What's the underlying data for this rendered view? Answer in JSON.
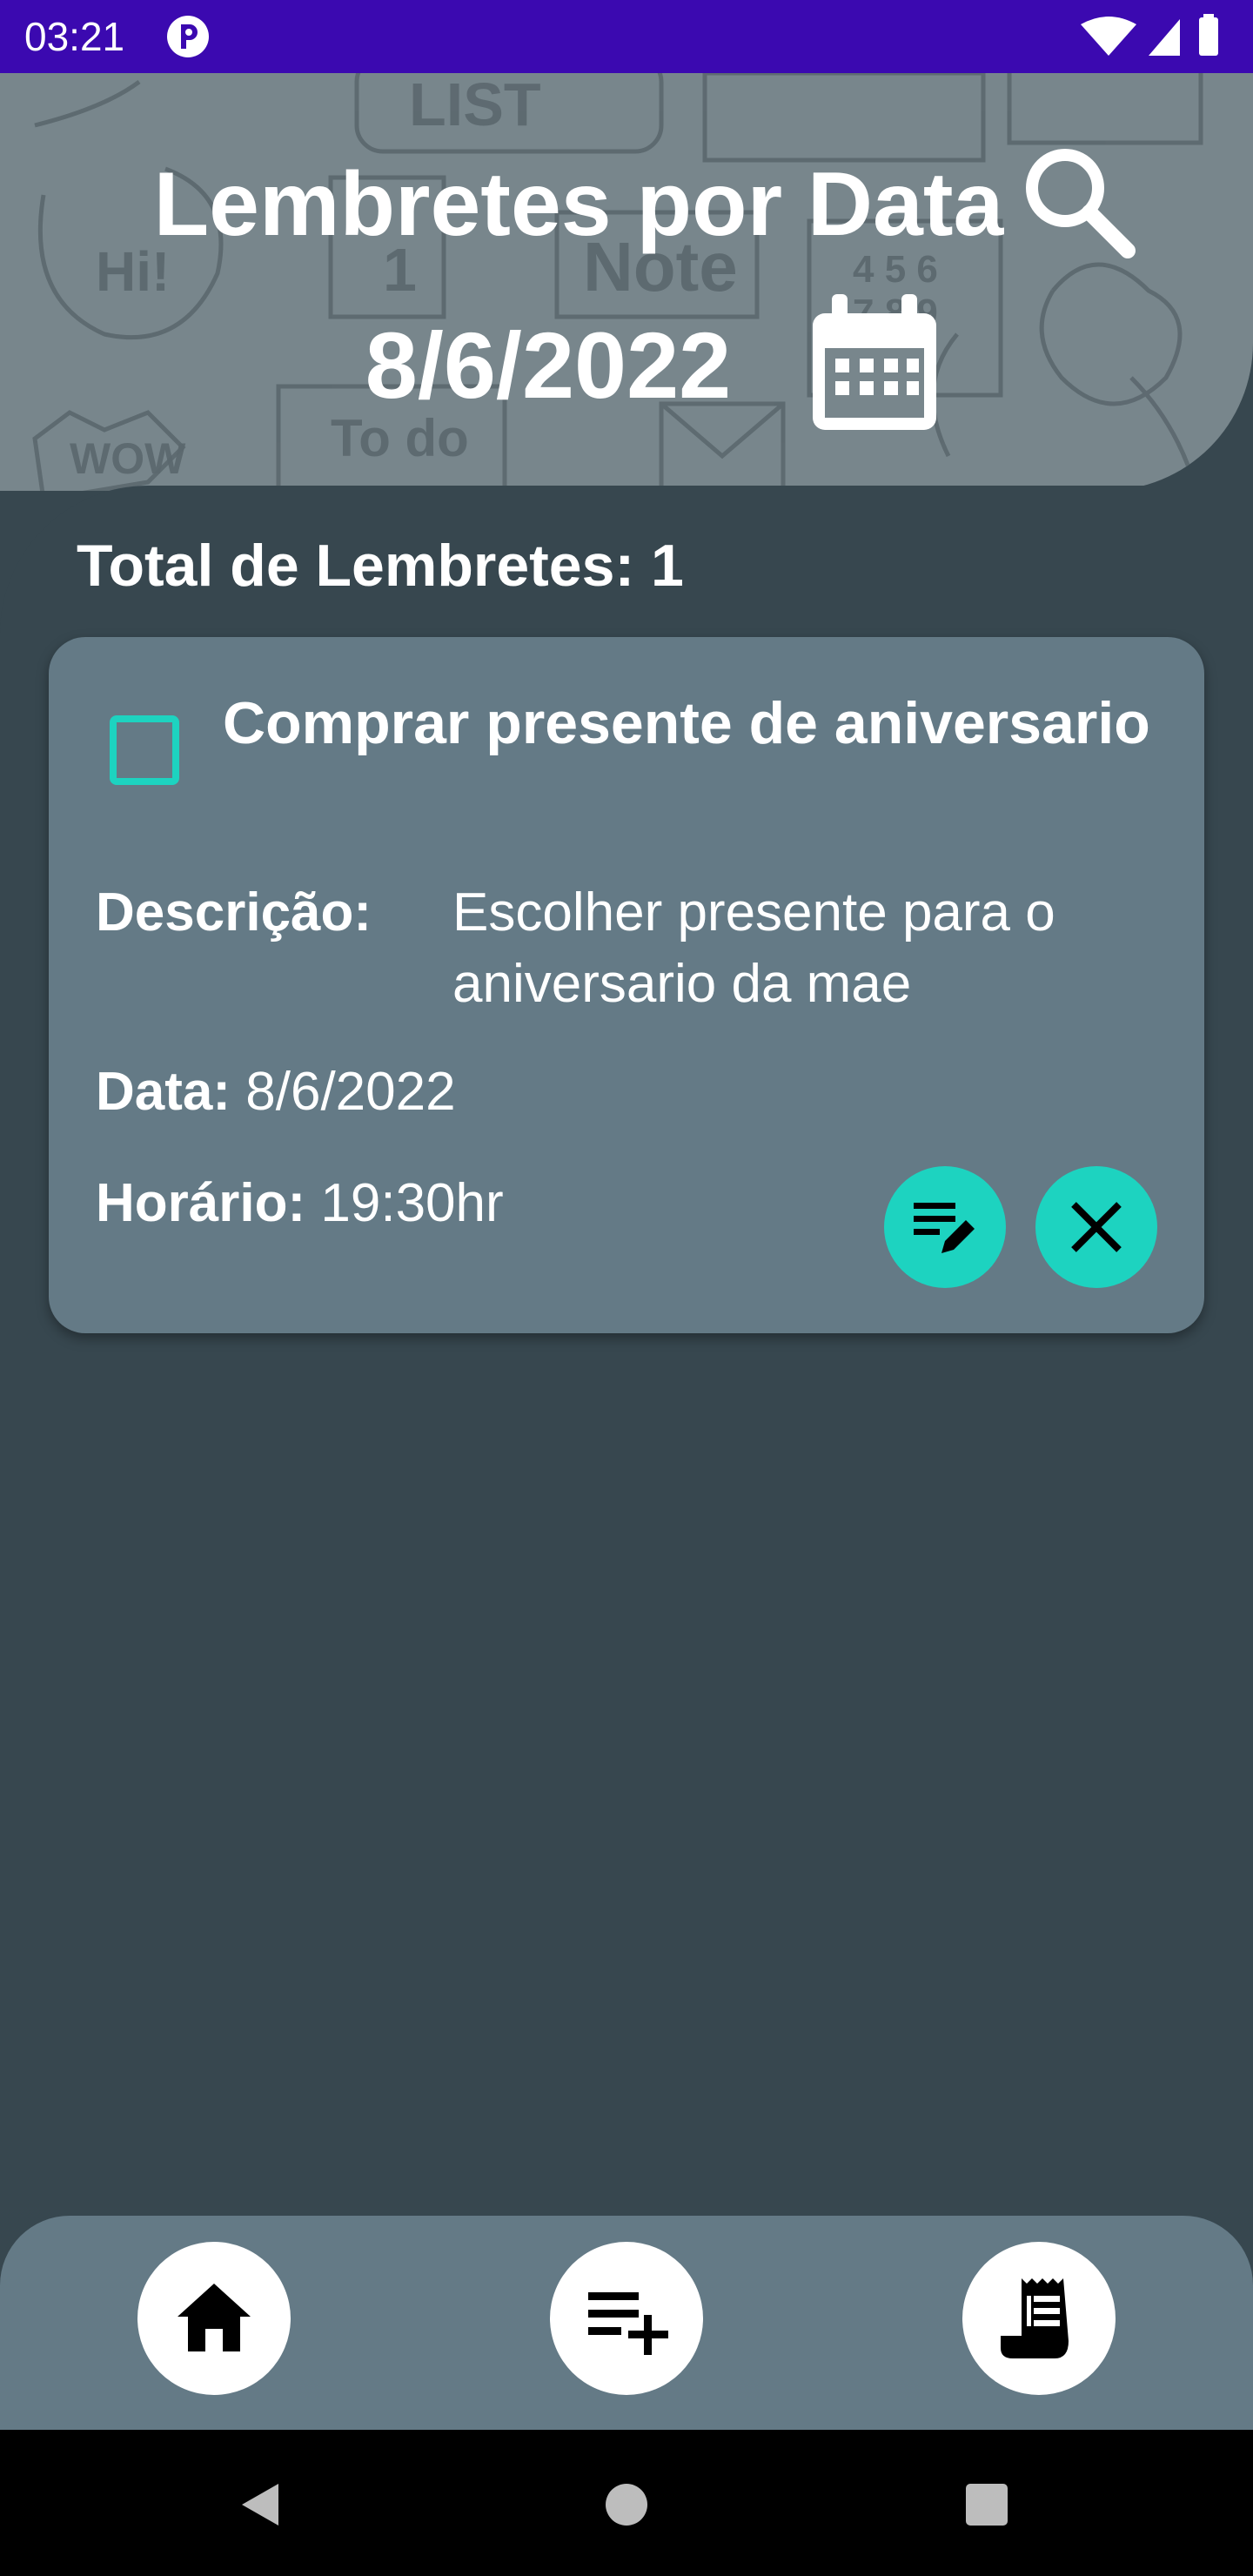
{
  "status_bar": {
    "time": "03:21",
    "icons": [
      "app-notification-icon",
      "wifi-icon",
      "cell-signal-icon",
      "battery-icon"
    ]
  },
  "header": {
    "title": "Lembretes por Data",
    "selected_date": "8/6/2022",
    "search_icon": "search-icon",
    "calendar_icon": "calendar-icon"
  },
  "summary": {
    "total_label": "Total de Lembretes: 1"
  },
  "reminders": [
    {
      "title": "Comprar presente de aniversario",
      "checked": false,
      "description_label": "Descrição:",
      "description": "Escolher presente para o aniversario da mae",
      "date_label": "Data:",
      "date": "8/6/2022",
      "time_label": "Horário:",
      "time": "19:30hr",
      "edit_icon": "edit-icon",
      "delete_icon": "close-icon"
    }
  ],
  "bottom_nav": {
    "items": [
      "home-icon",
      "add-list-icon",
      "receipt-icon"
    ]
  },
  "system_nav": [
    "back-icon",
    "home-circle-icon",
    "recents-icon"
  ],
  "colors": {
    "status_bar": "#3b09b0",
    "background": "#37474f",
    "card": "#647a86",
    "accent": "#1dd3c0",
    "header": "#78868c"
  }
}
